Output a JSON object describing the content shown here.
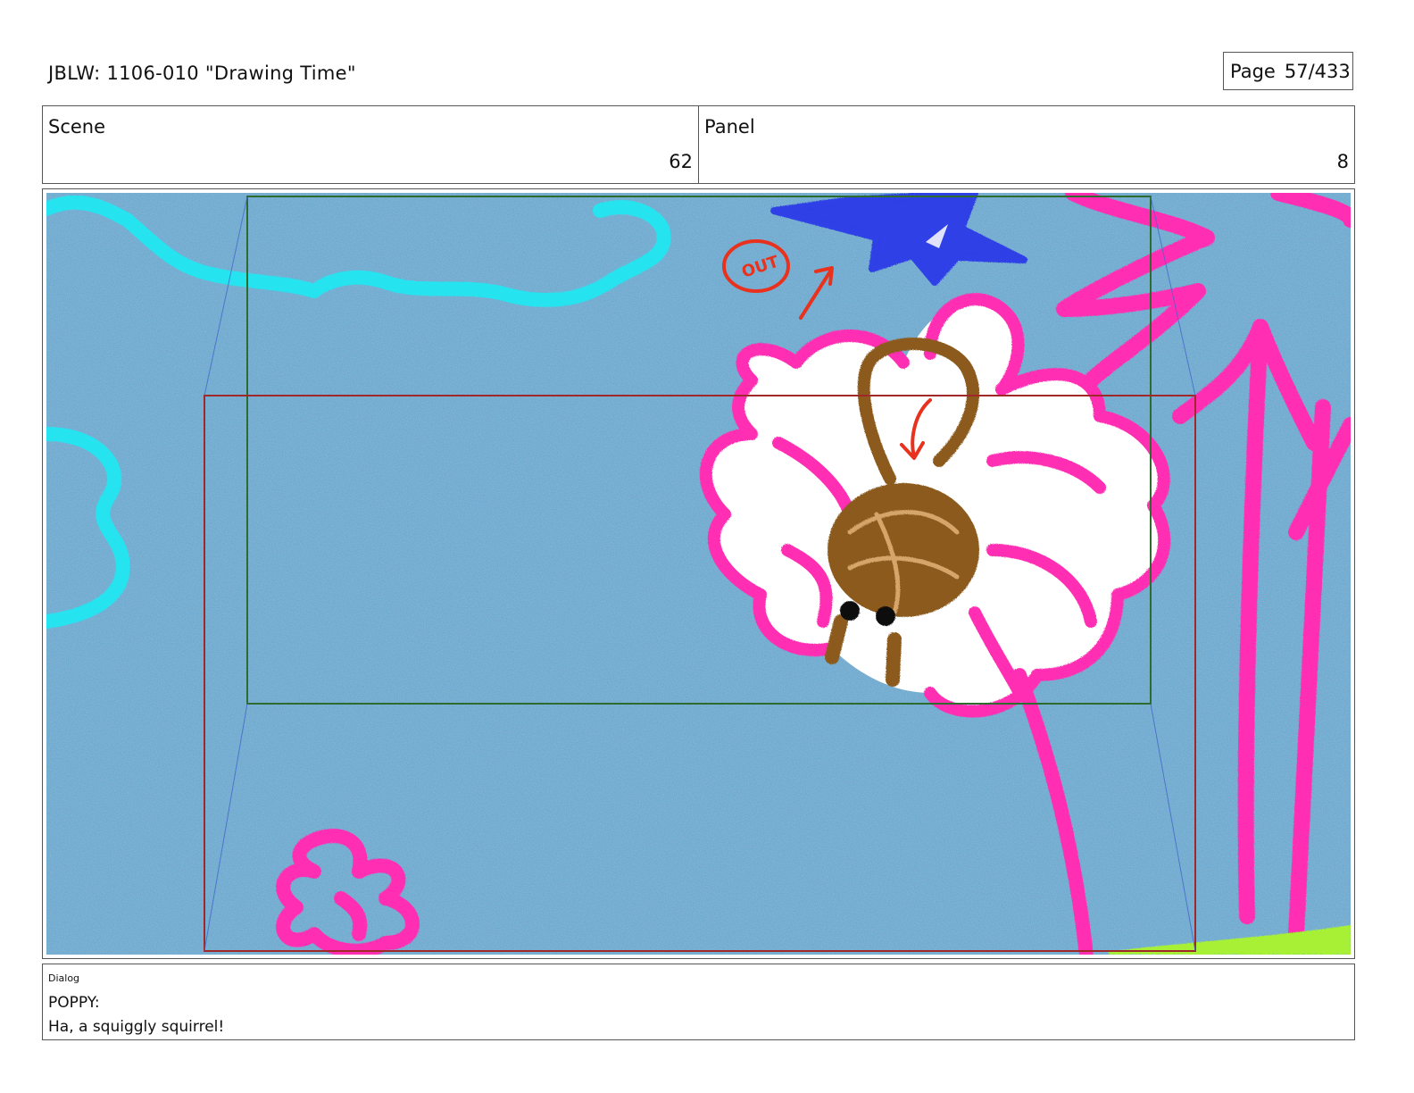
{
  "header": {
    "title": "JBLW: 1106-010 \"Drawing Time\"",
    "page_label": "Page",
    "page_value": "57/433"
  },
  "info": {
    "scene_label": "Scene",
    "scene_value": "62",
    "panel_label": "Panel",
    "panel_value": "8"
  },
  "artwork": {
    "background_color": "#5aa3cc",
    "annotation_text": "OUT",
    "colors": {
      "cloud": "#27e3f0",
      "star": "#2d3fe6",
      "flower": "#ff2fb3",
      "squirrel": "#8b5a1c",
      "annotation": "#e8321e",
      "grass": "#a8f035",
      "camera_start_frame": "#2e6b2e",
      "camera_end_frame": "#a02828",
      "camera_move_lines": "#4466cc"
    }
  },
  "dialog": {
    "label": "Dialog",
    "speaker": "POPPY:",
    "line": "Ha, a squiggly squirrel!"
  }
}
